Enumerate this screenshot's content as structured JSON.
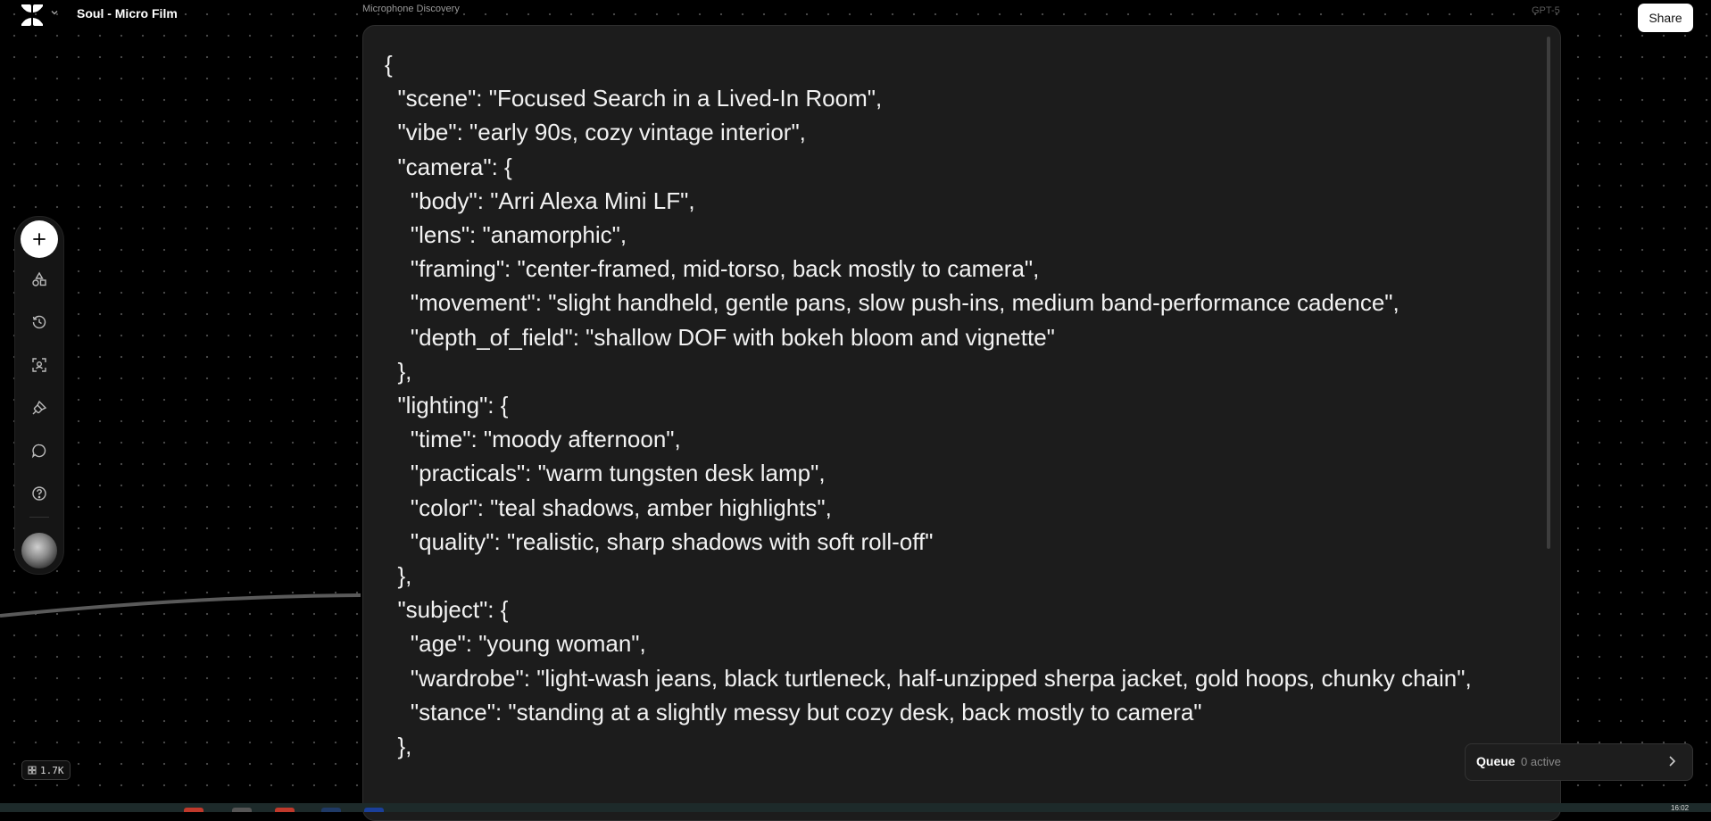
{
  "header": {
    "project_title": "Soul - Micro Film",
    "node_label": "Microphone Discovery",
    "model_label": "GPT-5",
    "share_label": "Share"
  },
  "toolbar": {
    "items": [
      {
        "name": "add",
        "icon": "plus-icon"
      },
      {
        "name": "assets",
        "icon": "shapes-icon"
      },
      {
        "name": "history",
        "icon": "history-icon"
      },
      {
        "name": "scan",
        "icon": "scan-face-icon"
      },
      {
        "name": "style",
        "icon": "paintbrush-icon"
      },
      {
        "name": "chat",
        "icon": "chat-bubble-icon"
      },
      {
        "name": "help",
        "icon": "help-circle-icon"
      }
    ]
  },
  "editor": {
    "lines": [
      "{",
      "  \"scene\": \"Focused Search in a Lived-In Room\",",
      "  \"vibe\": \"early 90s, cozy vintage interior\",",
      "  \"camera\": {",
      "    \"body\": \"Arri Alexa Mini LF\",",
      "    \"lens\": \"anamorphic\",",
      "    \"framing\": \"center-framed, mid-torso, back mostly to camera\",",
      "    \"movement\": \"slight handheld, gentle pans, slow push-ins, medium band-performance cadence\",",
      "    \"depth_of_field\": \"shallow DOF with bokeh bloom and vignette\"",
      "  },",
      "  \"lighting\": {",
      "    \"time\": \"moody afternoon\",",
      "    \"practicals\": \"warm tungsten desk lamp\",",
      "    \"color\": \"teal shadows, amber highlights\",",
      "    \"quality\": \"realistic, sharp shadows with soft roll-off\"",
      "  },",
      "  \"subject\": {",
      "    \"age\": \"young woman\",",
      "    \"wardrobe\": \"light-wash jeans, black turtleneck, half-unzipped sherpa jacket, gold hoops, chunky chain\",",
      "    \"stance\": \"standing at a slightly messy but cozy desk, back mostly to camera\"",
      "  },"
    ]
  },
  "credits": {
    "value": "1.7K",
    "icon": "credits-icon"
  },
  "queue": {
    "title": "Queue",
    "status": "0 active"
  },
  "taskbar": {
    "clock": "16:02"
  }
}
